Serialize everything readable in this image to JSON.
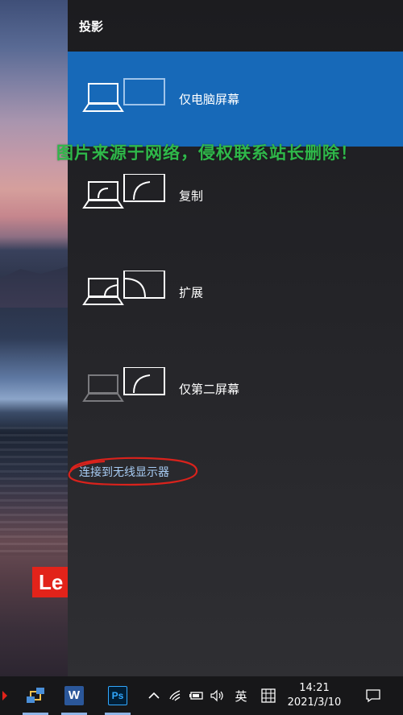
{
  "panel": {
    "title": "投影",
    "options": [
      {
        "label": "仅电脑屏幕",
        "selected": true,
        "icon": "pc-screen-only-icon"
      },
      {
        "label": "复制",
        "selected": false,
        "icon": "duplicate-icon"
      },
      {
        "label": "扩展",
        "selected": false,
        "icon": "extend-icon"
      },
      {
        "label": "仅第二屏幕",
        "selected": false,
        "icon": "second-screen-only-icon"
      }
    ],
    "wireless_link": "连接到无线显示器"
  },
  "watermark": "图片来源于网络，侵权联系站长删除！",
  "desktop": {
    "brand_logo": "Le"
  },
  "taskbar": {
    "apps": [
      {
        "name": "network-app-icon"
      },
      {
        "name": "word-icon",
        "label": "W"
      },
      {
        "name": "photoshop-icon",
        "label": "Ps"
      }
    ],
    "tray": {
      "ime": "英",
      "time": "14:21",
      "date": "2021/3/10"
    }
  },
  "colors": {
    "accent": "#1769b8",
    "link": "#a8cdf5",
    "watermark": "#2fb84a",
    "annotation": "#d9221c"
  }
}
